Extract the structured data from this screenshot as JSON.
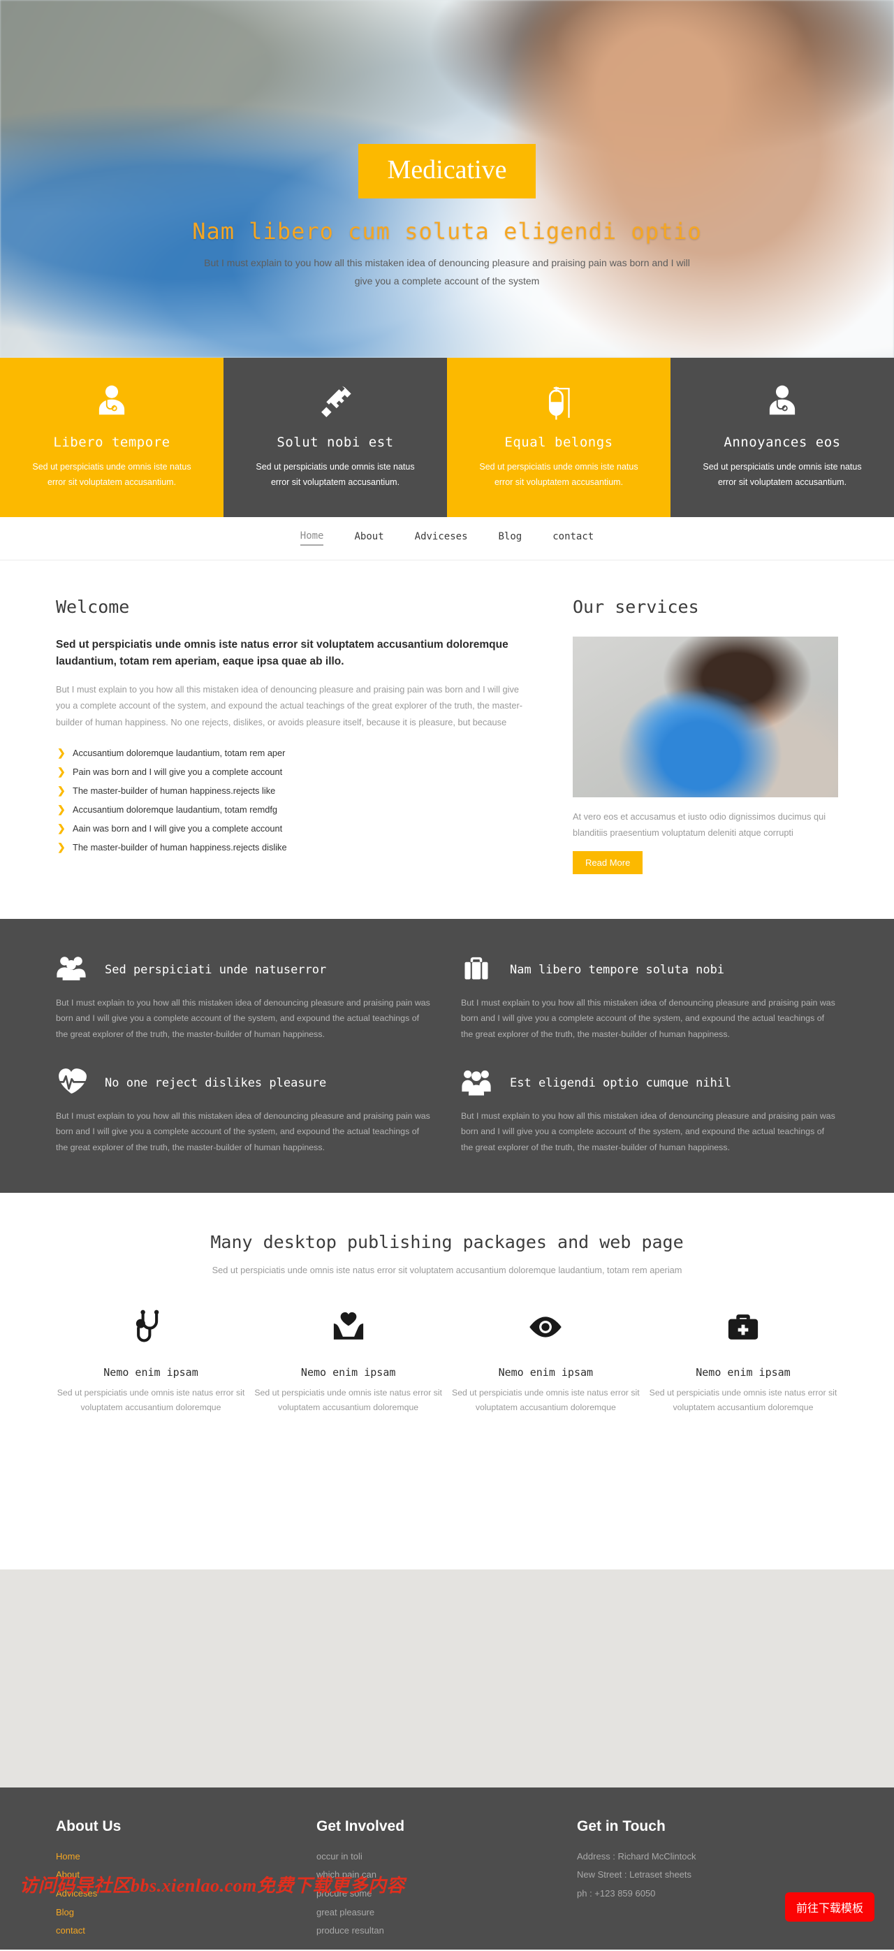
{
  "hero": {
    "brand": "Medicative",
    "title": "Nam libero cum soluta eligendi optio",
    "subtitle": "But I must explain to you how all this mistaken idea of denouncing pleasure and praising pain was born and I will give you a complete account of the system",
    "accent_color": "#fcb900",
    "title_color": "#f5a623"
  },
  "features": [
    {
      "icon": "doctor-icon",
      "title": "Libero tempore",
      "text": "Sed ut perspiciatis unde omnis iste natus error sit voluptatem accusantium.",
      "theme": "amber"
    },
    {
      "icon": "syringe-icon",
      "title": "Solut nobi est",
      "text": "Sed ut perspiciatis unde omnis iste natus error sit voluptatem accusantium.",
      "theme": "dark"
    },
    {
      "icon": "iv-drip-icon",
      "title": "Equal belongs",
      "text": "Sed ut perspiciatis unde omnis iste natus error sit voluptatem accusantium.",
      "theme": "amber"
    },
    {
      "icon": "doctor-icon",
      "title": "Annoyances eos",
      "text": "Sed ut perspiciatis unde omnis iste natus error sit voluptatem accusantium.",
      "theme": "dark"
    }
  ],
  "nav": {
    "items": [
      {
        "label": "Home",
        "active": true
      },
      {
        "label": "About",
        "active": false
      },
      {
        "label": "Adviceses",
        "active": false
      },
      {
        "label": "Blog",
        "active": false
      },
      {
        "label": "contact",
        "active": false
      }
    ]
  },
  "welcome": {
    "heading": "Welcome",
    "lead": "Sed ut perspiciatis unde omnis iste natus error sit voluptatem accusantium doloremque laudantium, totam rem aperiam, eaque ipsa quae ab illo.",
    "paragraph": "But I must explain to you how all this mistaken idea of denouncing pleasure and praising pain was born and I will give you a complete account of the system, and expound the actual teachings of the great explorer of the truth, the master-builder of human happiness. No one rejects, dislikes, or avoids pleasure itself, because it is pleasure, but because",
    "bullets": [
      "Accusantium doloremque laudantium, totam rem aper",
      "Pain was born and I will give you a complete account",
      "The master-builder of human happiness.rejects like",
      "Accusantium doloremque laudantium, totam remdfg",
      "Aain was born and I will give you a complete account",
      "The master-builder of human happiness.rejects dislike"
    ]
  },
  "services": {
    "heading": "Our services",
    "image_alt": "woman-holding-blue-heart-balloon",
    "text": "At vero eos et accusamus et iusto odio dignissimos ducimus qui blanditiis praesentium voluptatum deleniti atque corrupti",
    "button": "Read More"
  },
  "dark_panel": {
    "items": [
      {
        "icon": "group-icon",
        "title": "Sed perspiciati unde natuserror",
        "text": "But I must explain to you how all this mistaken idea of denouncing pleasure and praising pain was born and I will give you a complete account of the system, and expound the actual teachings of the great explorer of the truth, the master-builder of human happiness."
      },
      {
        "icon": "briefcase-icon",
        "title": "Nam libero tempore soluta nobi",
        "text": "But I must explain to you how all this mistaken idea of denouncing pleasure and praising pain was born and I will give you a complete account of the system, and expound the actual teachings of the great explorer of the truth, the master-builder of human happiness."
      },
      {
        "icon": "heartbeat-icon",
        "title": "No one reject dislikes pleasure",
        "text": "But I must explain to you how all this mistaken idea of denouncing pleasure and praising pain was born and I will give you a complete account of the system, and expound the actual teachings of the great explorer of the truth, the master-builder of human happiness."
      },
      {
        "icon": "people-icon",
        "title": "Est eligendi optio cumque nihil",
        "text": "But I must explain to you how all this mistaken idea of denouncing pleasure and praising pain was born and I will give you a complete account of the system, and expound the actual teachings of the great explorer of the truth, the master-builder of human happiness."
      }
    ]
  },
  "packages": {
    "title": "Many desktop publishing packages and web page",
    "subtitle": "Sed ut perspiciatis unde omnis iste natus error sit voluptatem accusantium doloremque laudantium, totam rem aperiam",
    "items": [
      {
        "icon": "stethoscope-icon",
        "name": "Nemo enim ipsam",
        "text": "Sed ut perspiciatis unde omnis iste natus error sit voluptatem accusantium doloremque"
      },
      {
        "icon": "heart-in-hands-icon",
        "name": "Nemo enim ipsam",
        "text": "Sed ut perspiciatis unde omnis iste natus error sit voluptatem accusantium doloremque"
      },
      {
        "icon": "eye-icon",
        "name": "Nemo enim ipsam",
        "text": "Sed ut perspiciatis unde omnis iste natus error sit voluptatem accusantium doloremque"
      },
      {
        "icon": "medical-bag-icon",
        "name": "Nemo enim ipsam",
        "text": "Sed ut perspiciatis unde omnis iste natus error sit voluptatem accusantium doloremque"
      }
    ]
  },
  "footer": {
    "about": {
      "heading": "About Us",
      "links": [
        "Home",
        "About",
        "Adviceses",
        "Blog",
        "contact"
      ]
    },
    "involved": {
      "heading": "Get Involved",
      "links": [
        "occur in toli",
        "which pain can",
        "procure some",
        "great pleasure",
        "produce resultan"
      ]
    },
    "touch": {
      "heading": "Get in Touch",
      "lines": [
        "Address : Richard McClintock",
        "New Street : Letraset sheets",
        "ph : +123 859 6050"
      ]
    },
    "watermark": "访问码导社区bbs.xienlao.com免费下载更多内容",
    "download_button": "前往下载模板"
  }
}
